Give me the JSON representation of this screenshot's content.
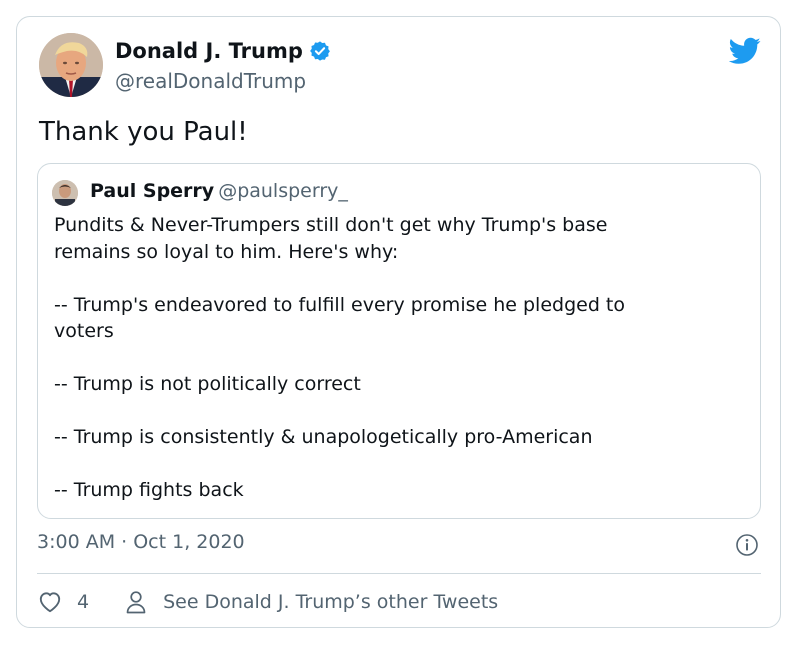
{
  "author": {
    "name": "Donald J. Trump",
    "handle": "@realDonaldTrump",
    "verified": true
  },
  "tweet": {
    "text": "Thank you Paul!",
    "timestamp": "3:00 AM · Oct 1, 2020"
  },
  "quoted_tweet": {
    "name": "Paul Sperry",
    "handle": "@paulsperry_",
    "lines": [
      "Pundits & Never-Trumpers still don't get why Trump's base",
      "remains so loyal to him. Here's why:",
      "",
      "-- Trump's endeavored to fulfill every promise he pledged to",
      "voters",
      "",
      "-- Trump is not politically correct",
      "",
      "-- Trump is consistently & unapologetically pro-American",
      "",
      "-- Trump fights back"
    ]
  },
  "actions": {
    "like_count": "4",
    "other_tweets_label": "See Donald J. Trump’s other Tweets"
  },
  "icons": {
    "brand": "twitter-bird-icon",
    "verified": "verified-badge-icon",
    "info": "info-icon",
    "like": "heart-icon",
    "profile": "person-icon"
  },
  "colors": {
    "brand_blue": "#1d9bf0",
    "text_primary": "#0f1419",
    "text_secondary": "#536471",
    "border": "#cfd9de"
  }
}
